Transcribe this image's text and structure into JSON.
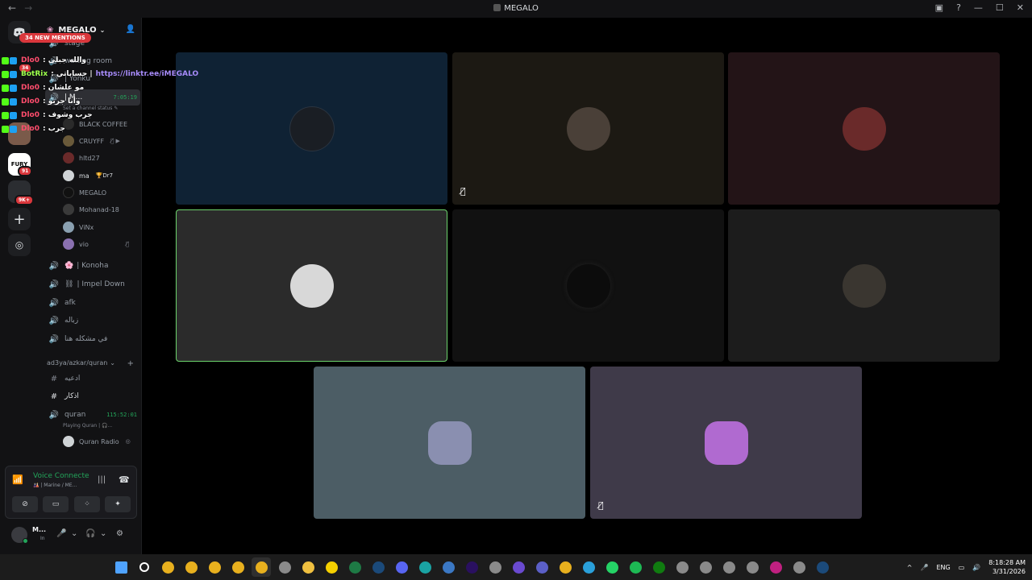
{
  "window": {
    "title": "MEGALO"
  },
  "server": {
    "name": "MEGALO",
    "mentions_label": "34 NEW MENTIONS"
  },
  "rail": {
    "badges": {
      "s1": "34",
      "fury": "91",
      "s4": "9K+"
    },
    "fury_label": "FURY"
  },
  "overlay": [
    {
      "name": "Dlo0",
      "name_color": "#ff4d6d",
      "msg": ": والله جبلى"
    },
    {
      "name": "BotRix",
      "name_color": "#9cff4a",
      "msg": ": حساباتي |",
      "link": "https://linktr.ee/iMEGALO"
    },
    {
      "name": "Dlo0",
      "name_color": "#ff4d6d",
      "msg": ": مو علشان"
    },
    {
      "name": "Dlo0",
      "name_color": "#ff4d6d",
      "msg": ": وأنا جربو"
    },
    {
      "name": "Dlo0",
      "name_color": "#ff4d6d",
      "msg": ": جرب وشوف"
    },
    {
      "name": "Dlo0",
      "name_color": "#ff4d6d",
      "msg": ": جرب"
    }
  ],
  "channels": {
    "top": [
      {
        "name": "stage"
      },
      {
        "name": "waiting room"
      },
      {
        "name": "| Yonku"
      }
    ],
    "active": {
      "name": "| M...",
      "timer": "7:05:19",
      "status": "Set a channel status"
    },
    "members": [
      {
        "name": "BLACK COFFEE",
        "color": "#2a2a2a",
        "tail": ""
      },
      {
        "name": "CRUYFF",
        "color": "#6a5a3a",
        "tail": "🎙̸ ▶"
      },
      {
        "name": "hltd27",
        "color": "#6a2a2a",
        "tail": ""
      },
      {
        "name": "ma",
        "color": "#cfd3d6",
        "tail": "🏆Dr7",
        "bright": true
      },
      {
        "name": "MEGALO",
        "color": "#111111",
        "tail": ""
      },
      {
        "name": "Mohanad-18",
        "color": "#3a3a3a",
        "tail": ""
      },
      {
        "name": "ViNx",
        "color": "#8aa0b0",
        "tail": ""
      },
      {
        "name": "vio",
        "color": "#8a70b0",
        "tail": "🎙̸"
      }
    ],
    "voice_more": [
      {
        "name": "| Konoha",
        "icon": "🌸"
      },
      {
        "name": "| Impel Down",
        "icon": "⛓"
      },
      {
        "name": "afk",
        "icon": ""
      },
      {
        "name": "زباله",
        "icon": ""
      },
      {
        "name": "في مشكله هنا",
        "icon": ""
      }
    ],
    "category": "ad3ya/azkar/quran",
    "text": [
      {
        "name": "ادعيه"
      },
      {
        "name": "اذكار"
      }
    ],
    "quran": {
      "name": "quran",
      "timer": "115:52:01",
      "status": "Playing Quran | 🎧...",
      "member": "Quran Radio"
    }
  },
  "voice_panel": {
    "title": "Voice Connected",
    "subtitle": "🎎 | Marine / ME..."
  },
  "user_panel": {
    "name": "M...",
    "status": "In"
  },
  "tiles": [
    {
      "bg": "#0f2234",
      "pic": "#1a1e24",
      "mute": false,
      "border": ""
    },
    {
      "bg": "#1c1913",
      "pic": "#4a4038",
      "mute": true,
      "border": ""
    },
    {
      "bg": "#231417",
      "pic": "#6a2a2a",
      "mute": false,
      "border": ""
    },
    {
      "bg": "#2b2b2b",
      "pic": "#d8d8d8",
      "mute": false,
      "border": "#6bd36b"
    },
    {
      "bg": "#111111",
      "pic": "#0c0c0c",
      "mute": false,
      "border": ""
    },
    {
      "bg": "#1c1c1c",
      "pic": "#3a3630",
      "mute": false,
      "border": ""
    },
    {
      "bg": "#4c5d65",
      "pic": "#8a8fb0",
      "mute": false,
      "border": ""
    },
    {
      "bg": "#3f3a49",
      "pic": "#b06ad0",
      "mute": true,
      "border": ""
    }
  ],
  "taskbar": {
    "apps": [
      "start",
      "search",
      "chrome",
      "chrome",
      "chrome",
      "chrome",
      "chrome",
      "app",
      "explorer",
      "notes",
      "excel",
      "steam",
      "discord",
      "edge",
      "photos",
      "premiere",
      "app",
      "video",
      "teams",
      "chrome",
      "telegram",
      "whatsapp",
      "spotify",
      "xbox",
      "app",
      "app",
      "app",
      "app",
      "iptv",
      "app",
      "steam"
    ],
    "lang": "ENG",
    "time": "8:18:28 AM",
    "date": "3/31/2026"
  }
}
